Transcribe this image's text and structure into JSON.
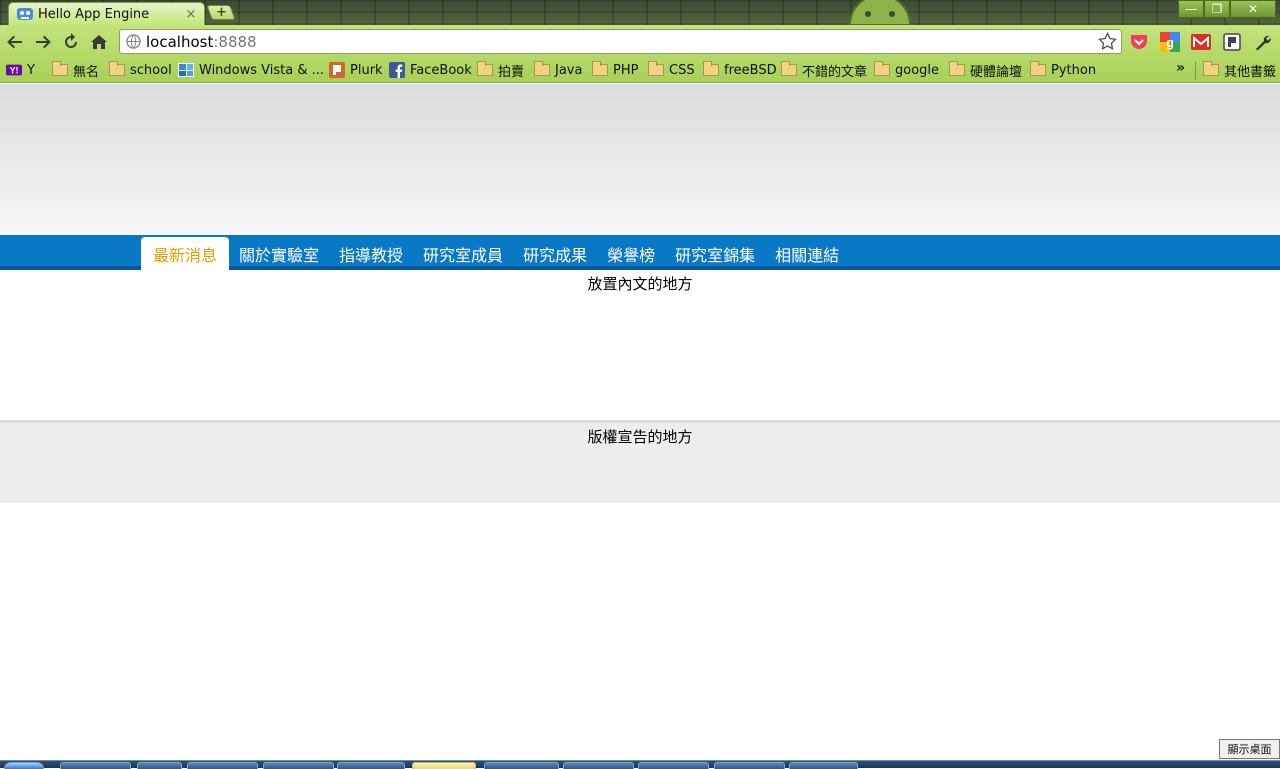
{
  "browser": {
    "tab_title": "Hello App Engine",
    "tab_close": "×",
    "new_tab": "+",
    "url_host": "localhost",
    "url_port": ":8888",
    "window_controls": {
      "minimize": "—",
      "restore": "❐",
      "close": "✕"
    }
  },
  "bookmarks": [
    {
      "label": "Y",
      "icon": "yahoo-icon"
    },
    {
      "label": "無名",
      "icon": "folder-icon"
    },
    {
      "label": "school",
      "icon": "folder-icon"
    },
    {
      "label": "Windows Vista & ...",
      "icon": "windows-icon"
    },
    {
      "label": "Plurk",
      "icon": "plurk-icon"
    },
    {
      "label": "FaceBook",
      "icon": "facebook-icon"
    },
    {
      "label": "拍賣",
      "icon": "folder-icon"
    },
    {
      "label": "Java",
      "icon": "folder-icon"
    },
    {
      "label": "PHP",
      "icon": "folder-icon"
    },
    {
      "label": "CSS",
      "icon": "folder-icon"
    },
    {
      "label": "freeBSD",
      "icon": "folder-icon"
    },
    {
      "label": "不錯的文章",
      "icon": "folder-icon"
    },
    {
      "label": "google",
      "icon": "folder-icon"
    },
    {
      "label": "硬體論壇",
      "icon": "folder-icon"
    },
    {
      "label": "Python",
      "icon": "folder-icon"
    }
  ],
  "bookmarks_more": "»",
  "other_bookmarks": "其他書籤",
  "site": {
    "nav": [
      "最新消息",
      "關於實驗室",
      "指導教授",
      "研究室成員",
      "研究成果",
      "榮譽榜",
      "研究室錦集",
      "相關連結"
    ],
    "active_nav": 0,
    "content_text": "放置內文的地方",
    "footer_text": "版權宣告的地方"
  },
  "taskbar": {
    "show_desktop": "顯示桌面"
  },
  "colors": {
    "nav_bg": "#0a79c5",
    "nav_active_text": "#e29d00",
    "chrome_green": "#b2d865"
  }
}
